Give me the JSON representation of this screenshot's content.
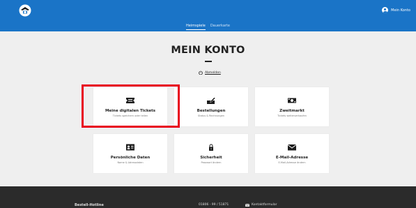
{
  "header": {
    "account_label": "Mein Konto"
  },
  "subnav": {
    "tabs": [
      {
        "label": "Heimspiele",
        "active": true
      },
      {
        "label": "Dauerkarte",
        "active": false
      }
    ]
  },
  "main": {
    "title": "MEIN KONTO",
    "logout_label": "Abmelden"
  },
  "cards": [
    {
      "label": "Meine digitalen Tickets",
      "sub": "Tickets speichern oder teilen",
      "icon": "ticket-icon",
      "highlighted": true
    },
    {
      "label": "Bestellungen",
      "sub": "Status & Rechnungen",
      "icon": "ticket-pen-icon"
    },
    {
      "label": "Zweitmarkt",
      "sub": "Tickets weiterverkaufen",
      "icon": "money-icon"
    },
    {
      "label": "Persönliche Daten",
      "sub": "Name & Adressdaten",
      "icon": "id-card-icon"
    },
    {
      "label": "Sicherheit",
      "sub": "Passwort ändern",
      "icon": "lock-icon"
    },
    {
      "label": "E-Mail-Adresse",
      "sub": "E-Mail-Adresse ändern",
      "icon": "envelope-icon"
    }
  ],
  "footer": {
    "hotline_label": "Bestell-Hotline",
    "phone": "01806 - 99 / 51871",
    "contact_label": "Kontaktformular"
  },
  "colors": {
    "brand_blue": "#1a74c7",
    "highlight_red": "#e8001d",
    "footer_bg": "#2b2b2b"
  }
}
